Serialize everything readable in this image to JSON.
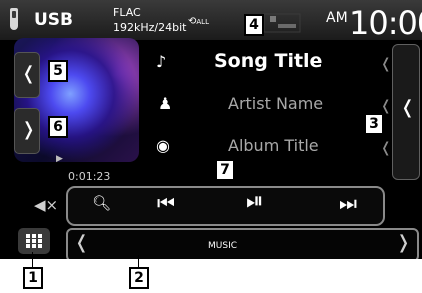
{
  "status": {
    "source": "USB",
    "format_line1": "FLAC",
    "format_line2": "192kHz/24bit",
    "repeat_label": "ALL",
    "ampm": "AM",
    "clock": "10:00"
  },
  "track": {
    "title": "Song Title",
    "artist": "Artist Name",
    "album": "Album Title",
    "elapsed": "0:01:23"
  },
  "function_bar": {
    "label": "MUSIC"
  },
  "callouts": [
    "1",
    "2",
    "3",
    "4",
    "5",
    "6",
    "7"
  ]
}
